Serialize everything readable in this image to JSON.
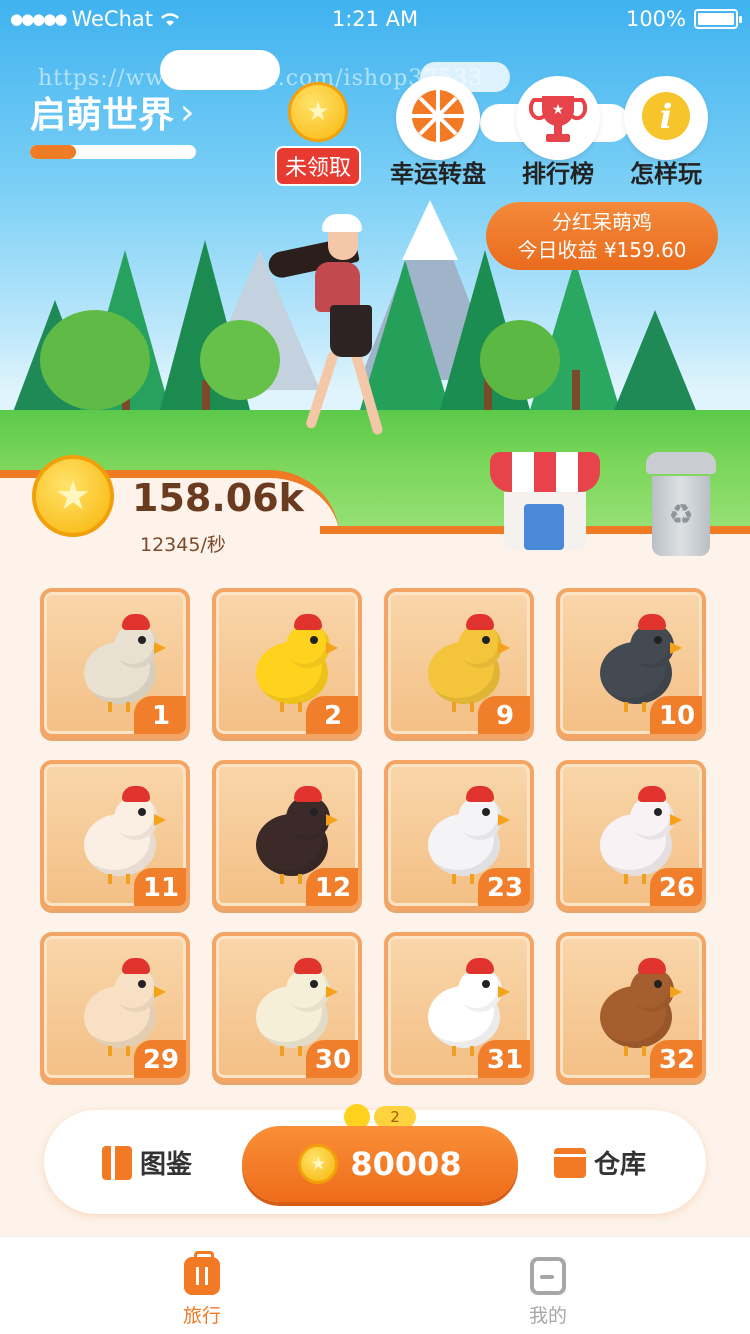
{
  "status_bar": {
    "carrier": "WeChat",
    "time": "1:21 AM",
    "battery": "100%"
  },
  "watermark": "https://www.huzhan.com/ishop37533",
  "world": {
    "title": "启萌世界",
    "progress_fraction": 0.28
  },
  "top_actions": [
    {
      "label": "未领取",
      "icon": "coin-icon"
    },
    {
      "label": "幸运转盘",
      "icon": "wheel-icon"
    },
    {
      "label": "排行榜",
      "icon": "trophy-icon"
    },
    {
      "label": "怎样玩",
      "icon": "info-icon"
    }
  ],
  "dividend": {
    "title": "分红呆萌鸡",
    "income": "今日收益 ¥159.60"
  },
  "coins": {
    "amount": "158.06k",
    "rate": "12345/秒"
  },
  "chickens": [
    {
      "level": "1",
      "color": "#e8e0d0"
    },
    {
      "level": "2",
      "color": "#ffd21d"
    },
    {
      "level": "9",
      "color": "#f4c53a"
    },
    {
      "level": "10",
      "color": "#444a52"
    },
    {
      "level": "11",
      "color": "#fbefe4"
    },
    {
      "level": "12",
      "color": "#3b2a28"
    },
    {
      "level": "23",
      "color": "#f4f4f6"
    },
    {
      "level": "26",
      "color": "#f9f2f5"
    },
    {
      "level": "29",
      "color": "#f7e0c4"
    },
    {
      "level": "30",
      "color": "#f6efd8"
    },
    {
      "level": "31",
      "color": "#ffffff"
    },
    {
      "level": "32",
      "color": "#a55e2e"
    }
  ],
  "action_bar": {
    "tujian_label": "图鉴",
    "buy_price": "80008",
    "buy_badge": "2",
    "warehouse_label": "仓库"
  },
  "tabs": [
    {
      "label": "旅行",
      "active": true
    },
    {
      "label": "我的",
      "active": false
    }
  ],
  "colors": {
    "accent": "#f27a24",
    "sky": "#3fb2ef",
    "grass": "#7ad65a",
    "cream": "#fdf3ea"
  }
}
